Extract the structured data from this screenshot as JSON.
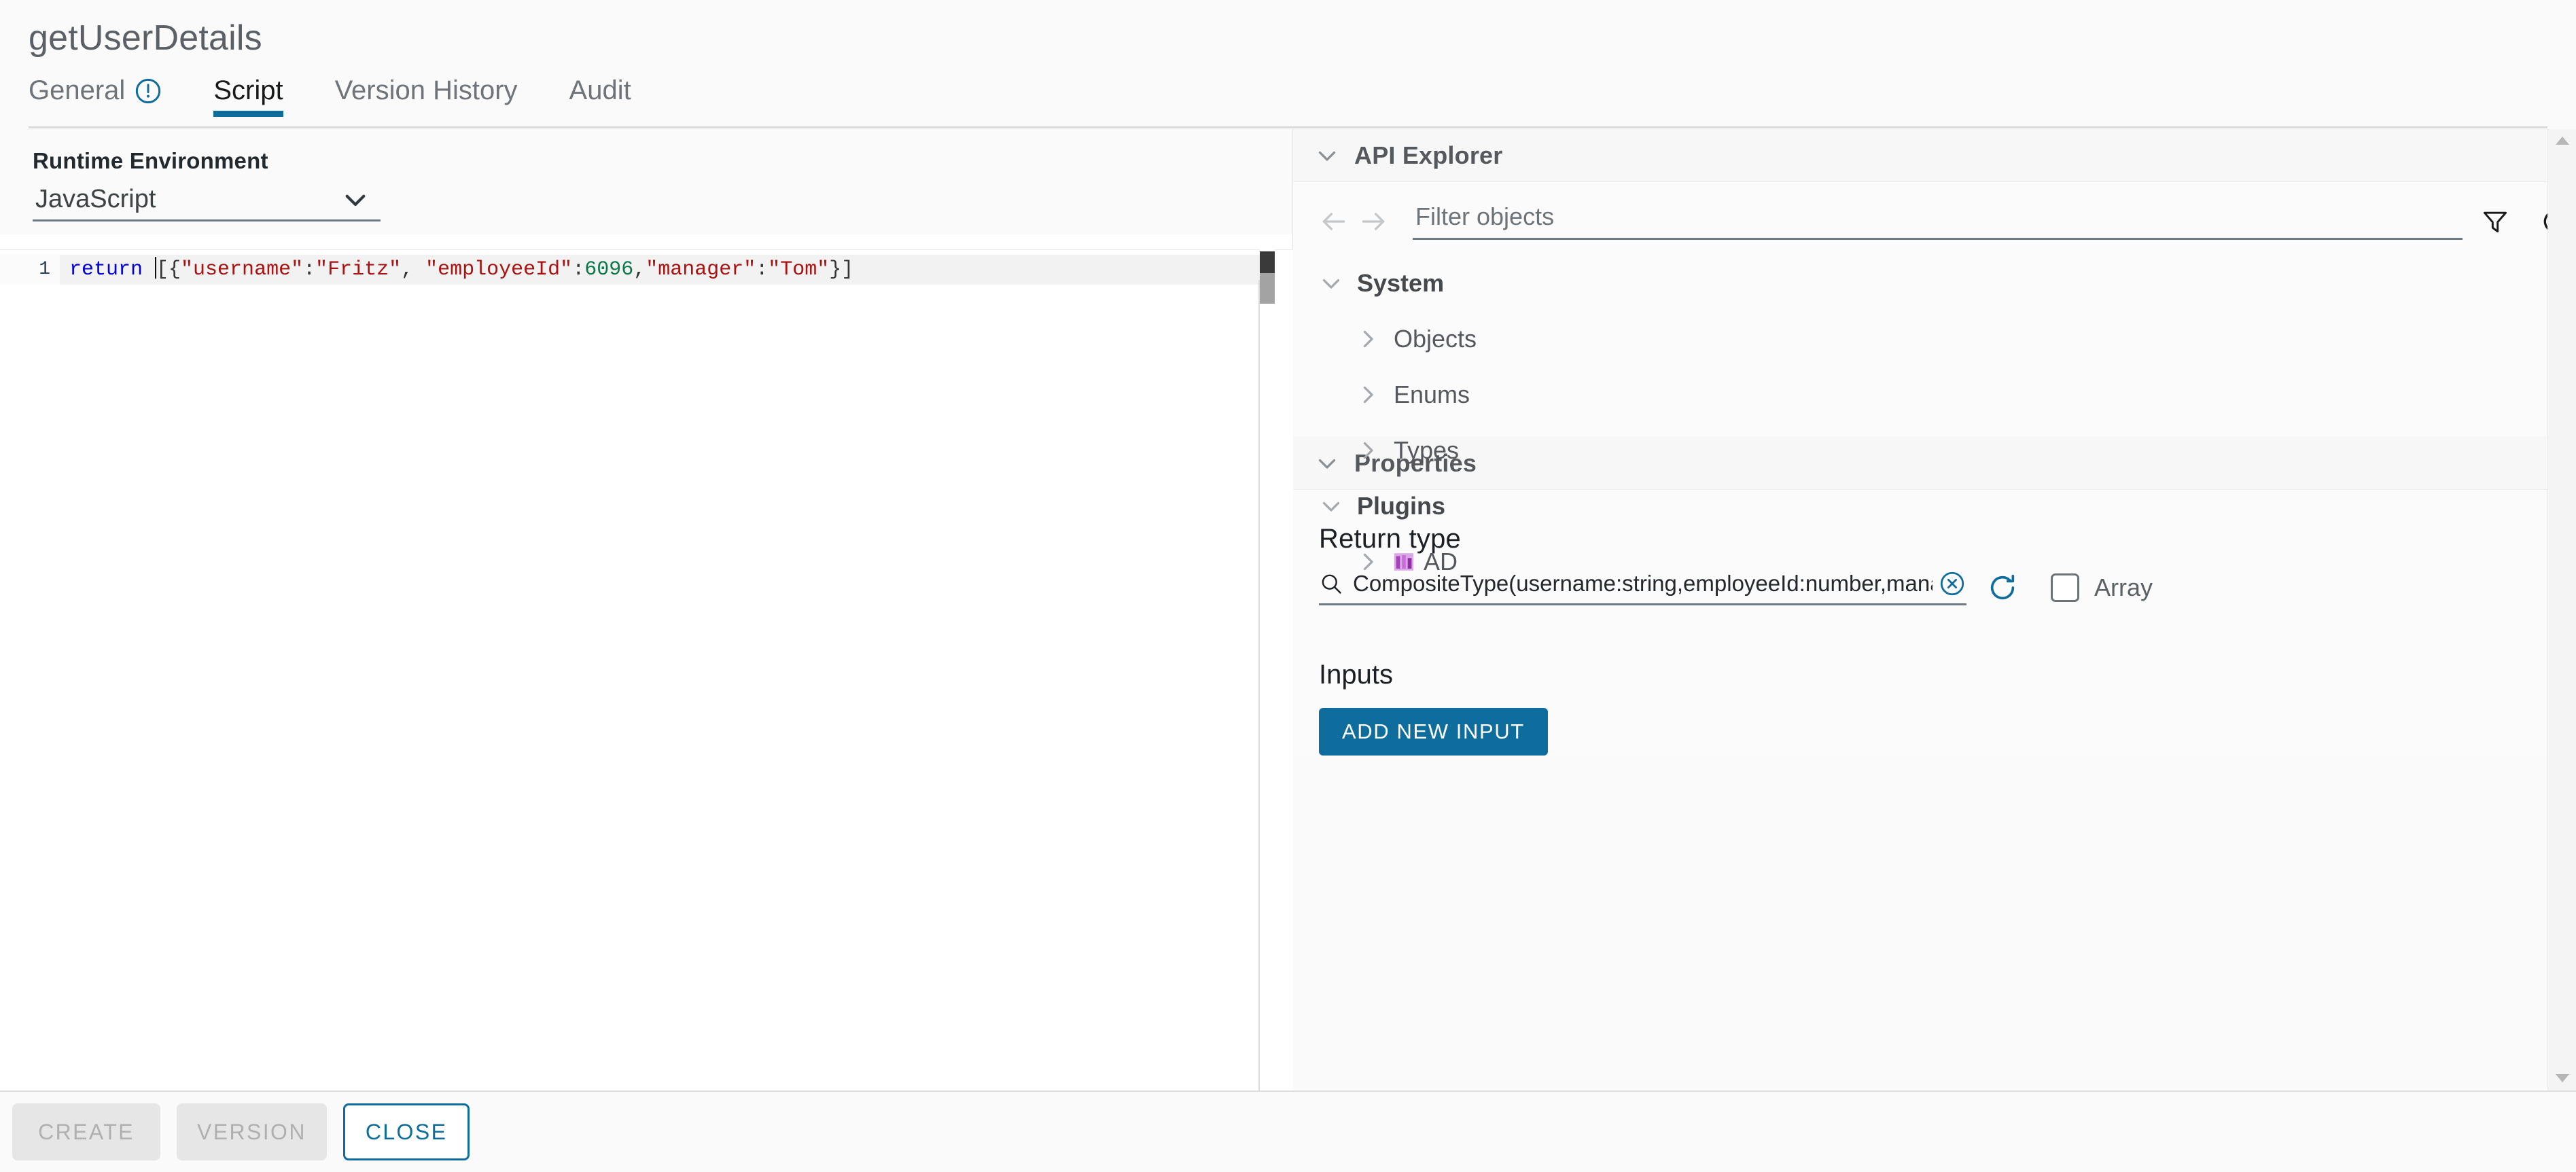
{
  "header": {
    "title": "getUserDetails",
    "tabs": [
      {
        "label": "General",
        "icon": "warning-circle-icon",
        "active": false
      },
      {
        "label": "Script",
        "icon": null,
        "active": true
      },
      {
        "label": "Version History",
        "icon": null,
        "active": false
      },
      {
        "label": "Audit",
        "icon": null,
        "active": false
      }
    ]
  },
  "editor": {
    "runtime_label": "Runtime Environment",
    "runtime_value": "JavaScript",
    "line_number": "1",
    "code": {
      "keyword": "return ",
      "open": "[{",
      "str_username": "\"username\"",
      "colon1": ":",
      "str_fritz": "\"Fritz\"",
      "comma1": ", ",
      "str_employeeid": "\"employeeId\"",
      "colon2": ":",
      "num_6096": "6096",
      "comma2": ",",
      "str_manager": "\"manager\"",
      "colon3": ":",
      "str_tom": "\"Tom\"",
      "close": "}]"
    },
    "full_code": "return [{\"username\":\"Fritz\", \"employeeId\":6096,\"manager\":\"Tom\"}]"
  },
  "api_explorer": {
    "title": "API Explorer",
    "filter_placeholder": "Filter objects",
    "filter_value": "",
    "tree": [
      {
        "label": "System",
        "level": 1,
        "expanded": true,
        "icon": null
      },
      {
        "label": "Objects",
        "level": 2,
        "expanded": false,
        "icon": null
      },
      {
        "label": "Enums",
        "level": 2,
        "expanded": false,
        "icon": null
      },
      {
        "label": "Types",
        "level": 2,
        "expanded": false,
        "icon": null
      },
      {
        "label": "Plugins",
        "level": 1,
        "expanded": true,
        "icon": null
      },
      {
        "label": "AD",
        "level": 2,
        "expanded": false,
        "icon": "plugin-icon"
      }
    ]
  },
  "properties": {
    "title": "Properties",
    "return_type_label": "Return type",
    "return_type_value": "CompositeType(username:string,employeeId:number,manager:strin",
    "array_label": "Array",
    "array_checked": false,
    "inputs_label": "Inputs",
    "add_input_label": "ADD NEW INPUT"
  },
  "footer": {
    "create_label": "CREATE",
    "version_label": "VERSION",
    "close_label": "CLOSE"
  },
  "colors": {
    "accent": "#0f6d9e",
    "text_muted": "#6e7479",
    "plugin_icon": "#b84fc4"
  }
}
